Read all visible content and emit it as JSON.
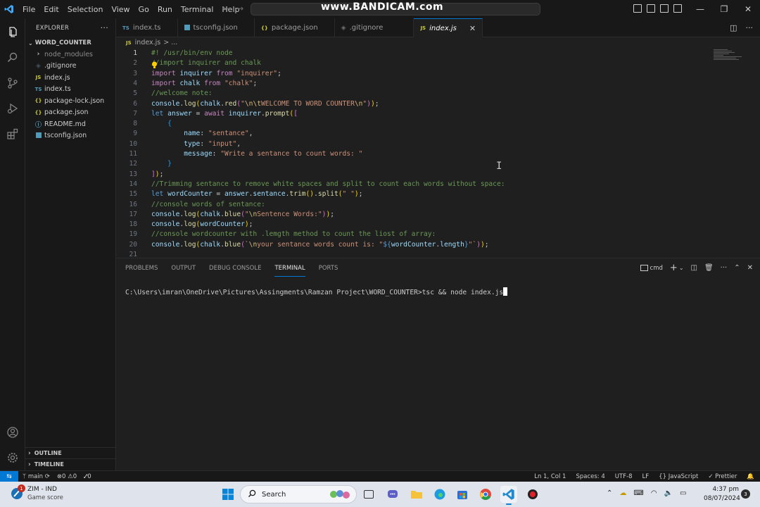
{
  "titlebar": {
    "menu": [
      "File",
      "Edit",
      "Selection",
      "View",
      "Go",
      "Run",
      "Terminal",
      "Help"
    ],
    "watermark": "www.BANDICAM.com"
  },
  "sidebar": {
    "title": "EXPLORER",
    "more": "···",
    "folder": "WORD_COUNTER",
    "items": [
      {
        "label": "node_modules",
        "icon": "chevron-right-icon"
      },
      {
        "label": ".gitignore",
        "icon": "git-icon"
      },
      {
        "label": "index.js",
        "icon": "JS"
      },
      {
        "label": "index.ts",
        "icon": "TS"
      },
      {
        "label": "package-lock.json",
        "icon": "{}"
      },
      {
        "label": "package.json",
        "icon": "{}"
      },
      {
        "label": "README.md",
        "icon": "info-icon"
      },
      {
        "label": "tsconfig.json",
        "icon": "tsconfig-icon"
      }
    ],
    "outline": "OUTLINE",
    "timeline": "TIMELINE"
  },
  "tabs": [
    {
      "label": "index.ts",
      "icon": "TS"
    },
    {
      "label": "tsconfig.json",
      "icon": "tsconfig-icon"
    },
    {
      "label": "package.json",
      "icon": "{}"
    },
    {
      "label": ".gitignore",
      "icon": "git-icon"
    },
    {
      "label": "index.js",
      "icon": "JS",
      "active": true
    }
  ],
  "breadcrumb": {
    "file": "index.js",
    "rest": "> ..."
  },
  "editor": {
    "line_numbers": [
      "1",
      "2",
      "3",
      "4",
      "5",
      "6",
      "7",
      "8",
      "9",
      "10",
      "11",
      "12",
      "13",
      "14",
      "15",
      "16",
      "17",
      "18",
      "19",
      "20",
      "21"
    ],
    "current_line": 1
  },
  "panel": {
    "tabs": [
      "PROBLEMS",
      "OUTPUT",
      "DEBUG CONSOLE",
      "TERMINAL",
      "PORTS"
    ],
    "active_tab": "TERMINAL",
    "shell": "cmd",
    "prompt": "C:\\Users\\imran\\OneDrive\\Pictures\\Assingments\\Ramzan Project\\WORD_COUNTER>",
    "command": "tsc && node index.js"
  },
  "statusbar": {
    "branch": "main",
    "errors": "0",
    "warnings": "0",
    "ports": "0",
    "position": "Ln 1, Col 1",
    "spaces": "Spaces: 4",
    "encoding": "UTF-8",
    "eol": "LF",
    "language": "JavaScript",
    "formatter": "Prettier"
  },
  "taskbar": {
    "widget_title": "ZIM - IND",
    "widget_sub": "Game score",
    "widget_badge": "1",
    "search": "Search",
    "time": "4:37 pm",
    "date": "08/07/2024",
    "notifications": "3"
  },
  "colors": {
    "accent": "#0078d4",
    "background": "#1f1f1f",
    "sidebar": "#181818"
  }
}
